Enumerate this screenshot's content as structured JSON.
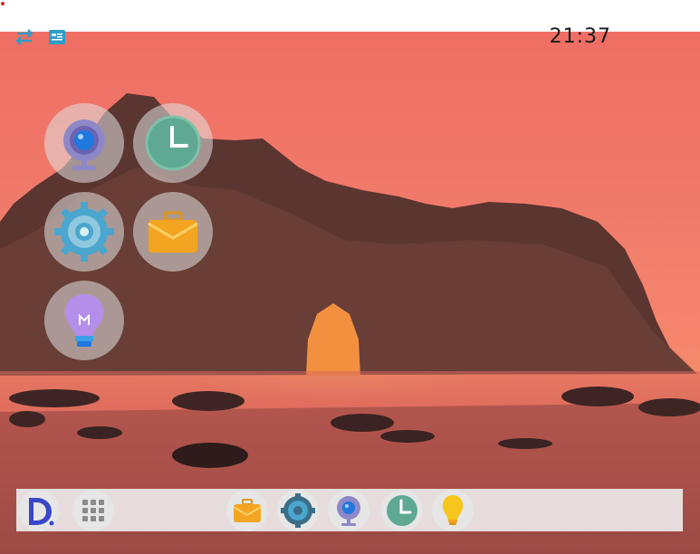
{
  "status": {
    "clock": "21:37",
    "left_icons": [
      "transfer-arrows-icon",
      "notes-card-icon"
    ]
  },
  "launcher": {
    "apps": [
      {
        "icon": "webcam-icon"
      },
      {
        "icon": "clock-icon"
      },
      {
        "icon": "settings-gear-icon"
      },
      {
        "icon": "briefcase-icon"
      },
      {
        "icon": "lightbulb-icon"
      }
    ]
  },
  "dock": {
    "items": [
      {
        "icon": "logo-d-icon"
      },
      {
        "icon": "app-grid-icon"
      },
      {
        "icon": "briefcase-icon"
      },
      {
        "icon": "settings-gear-icon"
      },
      {
        "icon": "webcam-icon"
      },
      {
        "icon": "clock-icon"
      },
      {
        "icon": "lightbulb-icon"
      }
    ]
  },
  "colors": {
    "accent_blue": "#2e9ec8",
    "sky": "#ef6e63",
    "rock": "#5a3530",
    "clock_face": "#5fa992",
    "briefcase": "#f3a522",
    "bulb_purple": "#b48ee8",
    "bulb_yellow": "#f7c61c"
  }
}
